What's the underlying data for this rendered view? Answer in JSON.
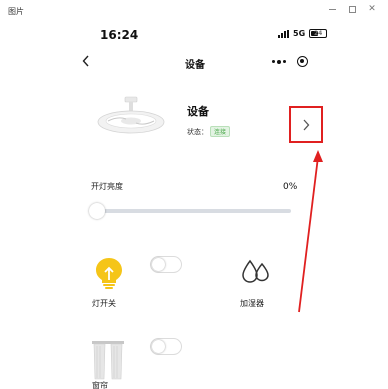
{
  "window": {
    "title": "图片"
  },
  "status_bar": {
    "time": "16:24",
    "network": "5G",
    "battery_level": "24"
  },
  "nav": {
    "title": "设备"
  },
  "device": {
    "name": "设备",
    "status_prefix": "状态：",
    "status_value": "连接"
  },
  "light": {
    "label": "开灯亮度",
    "value": "0%",
    "brightness_fraction": 0.0
  },
  "tiles": [
    {
      "label": "灯开关",
      "icon": "bulb-icon",
      "toggle_on": false
    },
    {
      "label": "加湿器",
      "icon": "water-drops-icon"
    },
    {
      "label": "窗帘",
      "icon": "curtain-icon",
      "toggle_on": false
    }
  ],
  "colors": {
    "accent_red": "#e02020",
    "bulb_yellow": "#f5c518",
    "status_green": "#4aa84a"
  }
}
